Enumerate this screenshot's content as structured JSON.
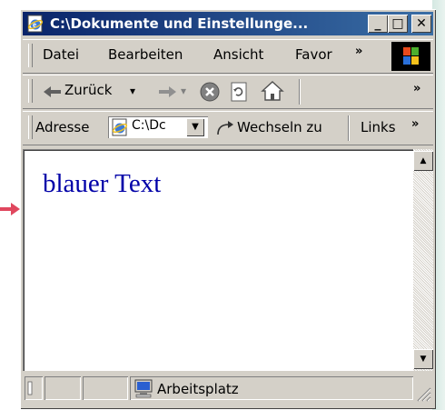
{
  "window": {
    "title": "C:\\Dokumente und Einstellunge...",
    "minimize_label": "_",
    "maximize_label": "□",
    "close_label": "✕"
  },
  "menubar": {
    "items": [
      {
        "label": "Datei"
      },
      {
        "label": "Bearbeiten"
      },
      {
        "label": "Ansicht"
      },
      {
        "label": "Favor"
      }
    ],
    "overflow": "»"
  },
  "toolbar": {
    "back_label": "Zurück",
    "back_dropdown": "▾",
    "forward_dropdown": "▾",
    "overflow": "»"
  },
  "addressbar": {
    "label": "Adresse",
    "value": "C:\\Dc",
    "go_label": "Wechseln zu",
    "links_label": "Links",
    "links_overflow": "»"
  },
  "content": {
    "text": "blauer Text",
    "text_color": "#0000a8"
  },
  "statusbar": {
    "zone_label": "Arbeitsplatz"
  },
  "colors": {
    "titlebar_start": "#0a246a",
    "titlebar_end": "#3a6ea5",
    "face": "#d4d0c8",
    "pointer_arrow": "#e0475e"
  },
  "icons": [
    "ie-page-icon",
    "windows-logo",
    "back-arrow-icon",
    "forward-arrow-icon",
    "stop-icon",
    "refresh-icon",
    "home-icon",
    "go-arrow-icon",
    "computer-icon",
    "resize-grip-icon",
    "pointer-arrow-icon"
  ]
}
